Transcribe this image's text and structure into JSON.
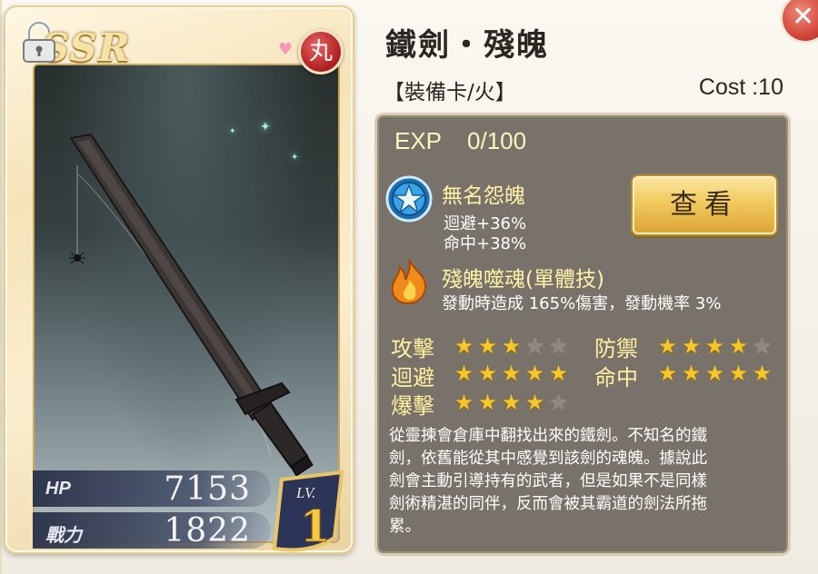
{
  "card": {
    "rarity": "SSR",
    "element_icon": "fire-element-icon",
    "element_glyph": "丸",
    "hp_label": "HP",
    "hp_value": "7153",
    "power_label": "戰力",
    "power_value": "1822",
    "level_label": "LV.",
    "level_value": "1"
  },
  "header": {
    "title": "鐵劍・殘魄",
    "subtitle": "【裝備卡/火】",
    "cost": "Cost :10"
  },
  "exp": {
    "label": "EXP",
    "value": "0/100"
  },
  "skills": [
    {
      "icon": "star-badge-icon",
      "name": "無名怨魄",
      "lines": [
        "迴避+36%",
        "命中+38%"
      ]
    },
    {
      "icon": "flame-icon",
      "name": "殘魄噬魂(單體技)",
      "lines": [
        "發動時造成 165%傷害，發動機率 3%"
      ]
    }
  ],
  "view_button": "查看",
  "attributes": [
    {
      "label": "攻擊",
      "stars": 3,
      "max": 5
    },
    {
      "label": "防禦",
      "stars": 4,
      "max": 5
    },
    {
      "label": "迴避",
      "stars": 5,
      "max": 5
    },
    {
      "label": "命中",
      "stars": 5,
      "max": 5
    },
    {
      "label": "爆擊",
      "stars": 4,
      "max": 5
    }
  ],
  "description": "從靈揀會倉庫中翻找出來的鐵劍。不知名的鐵\n劍，依舊能從其中感覺到該劍的魂魄。據說此\n劍會主動引導持有的武者，但是如果不是同樣\n劍術精湛的同伴，反而會被其霸道的劍法所拖\n累。",
  "colors": {
    "accent_gold": "#f7c62a",
    "label_yellow": "#fff0a0",
    "panel_bg": "#78726a",
    "close_red": "#d3483b"
  }
}
